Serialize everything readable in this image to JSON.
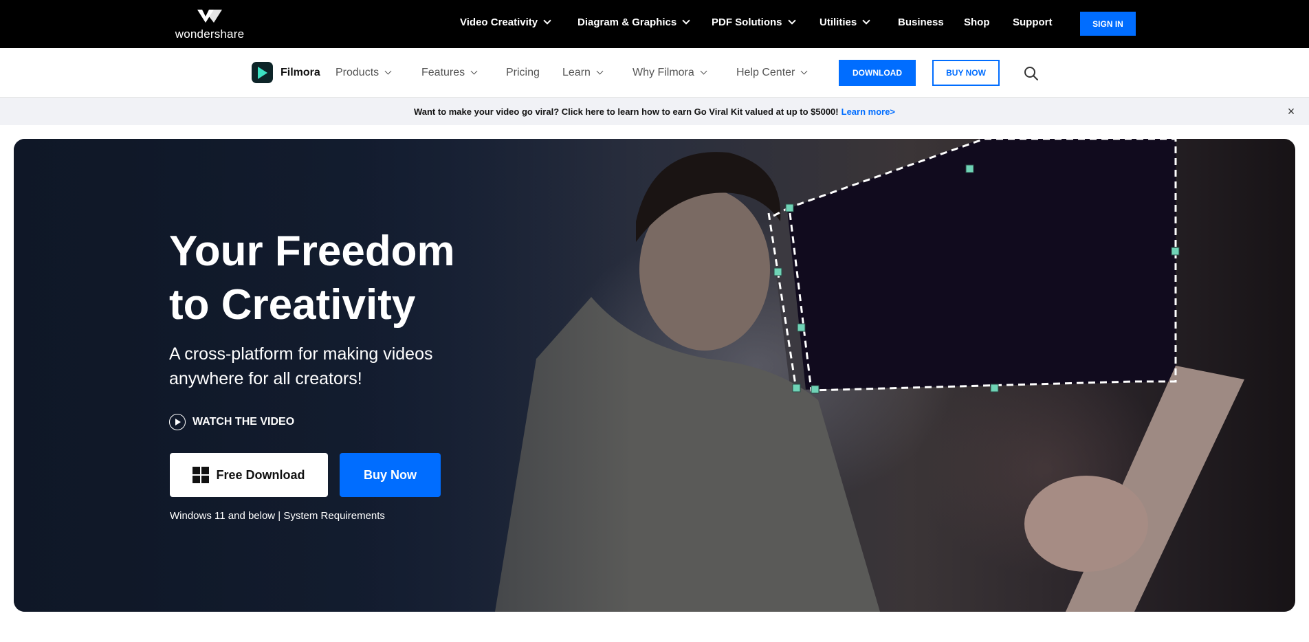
{
  "topbar": {
    "brand": "wondershare",
    "nav": [
      {
        "label": "Video Creativity",
        "dropdown": true
      },
      {
        "label": "Diagram & Graphics",
        "dropdown": true
      },
      {
        "label": "PDF Solutions",
        "dropdown": true
      },
      {
        "label": "Utilities",
        "dropdown": true
      },
      {
        "label": "Business",
        "dropdown": false
      },
      {
        "label": "Shop",
        "dropdown": false
      },
      {
        "label": "Support",
        "dropdown": false
      }
    ],
    "signin_label": "SIGN IN"
  },
  "product_nav": {
    "product_name": "Filmora",
    "items": [
      {
        "label": "Products",
        "dropdown": true
      },
      {
        "label": "Features",
        "dropdown": true
      },
      {
        "label": "Pricing",
        "dropdown": false
      },
      {
        "label": "Learn",
        "dropdown": true
      },
      {
        "label": "Why Filmora",
        "dropdown": true
      },
      {
        "label": "Help Center",
        "dropdown": true
      }
    ],
    "download_label": "DOWNLOAD",
    "buy_label": "BUY NOW",
    "search_icon": "search-icon"
  },
  "announcement": {
    "text": "Want to make your video go viral? Click here to learn how to earn Go Viral Kit valued at up to $5000!",
    "link": "Learn more>",
    "close": "×"
  },
  "hero": {
    "title_line1": "Your Freedom",
    "title_line2": "to Creativity",
    "subtitle_line1": "A cross-platform for making videos",
    "subtitle_line2": "anywhere for all creators!",
    "watch_label": "WATCH THE VIDEO",
    "free_download_label": "Free Download",
    "buy_now_label": "Buy Now",
    "system_note": "Windows 11 and below | System Requirements"
  },
  "colors": {
    "accent": "#006dff",
    "handle": "#6fd3b6"
  }
}
